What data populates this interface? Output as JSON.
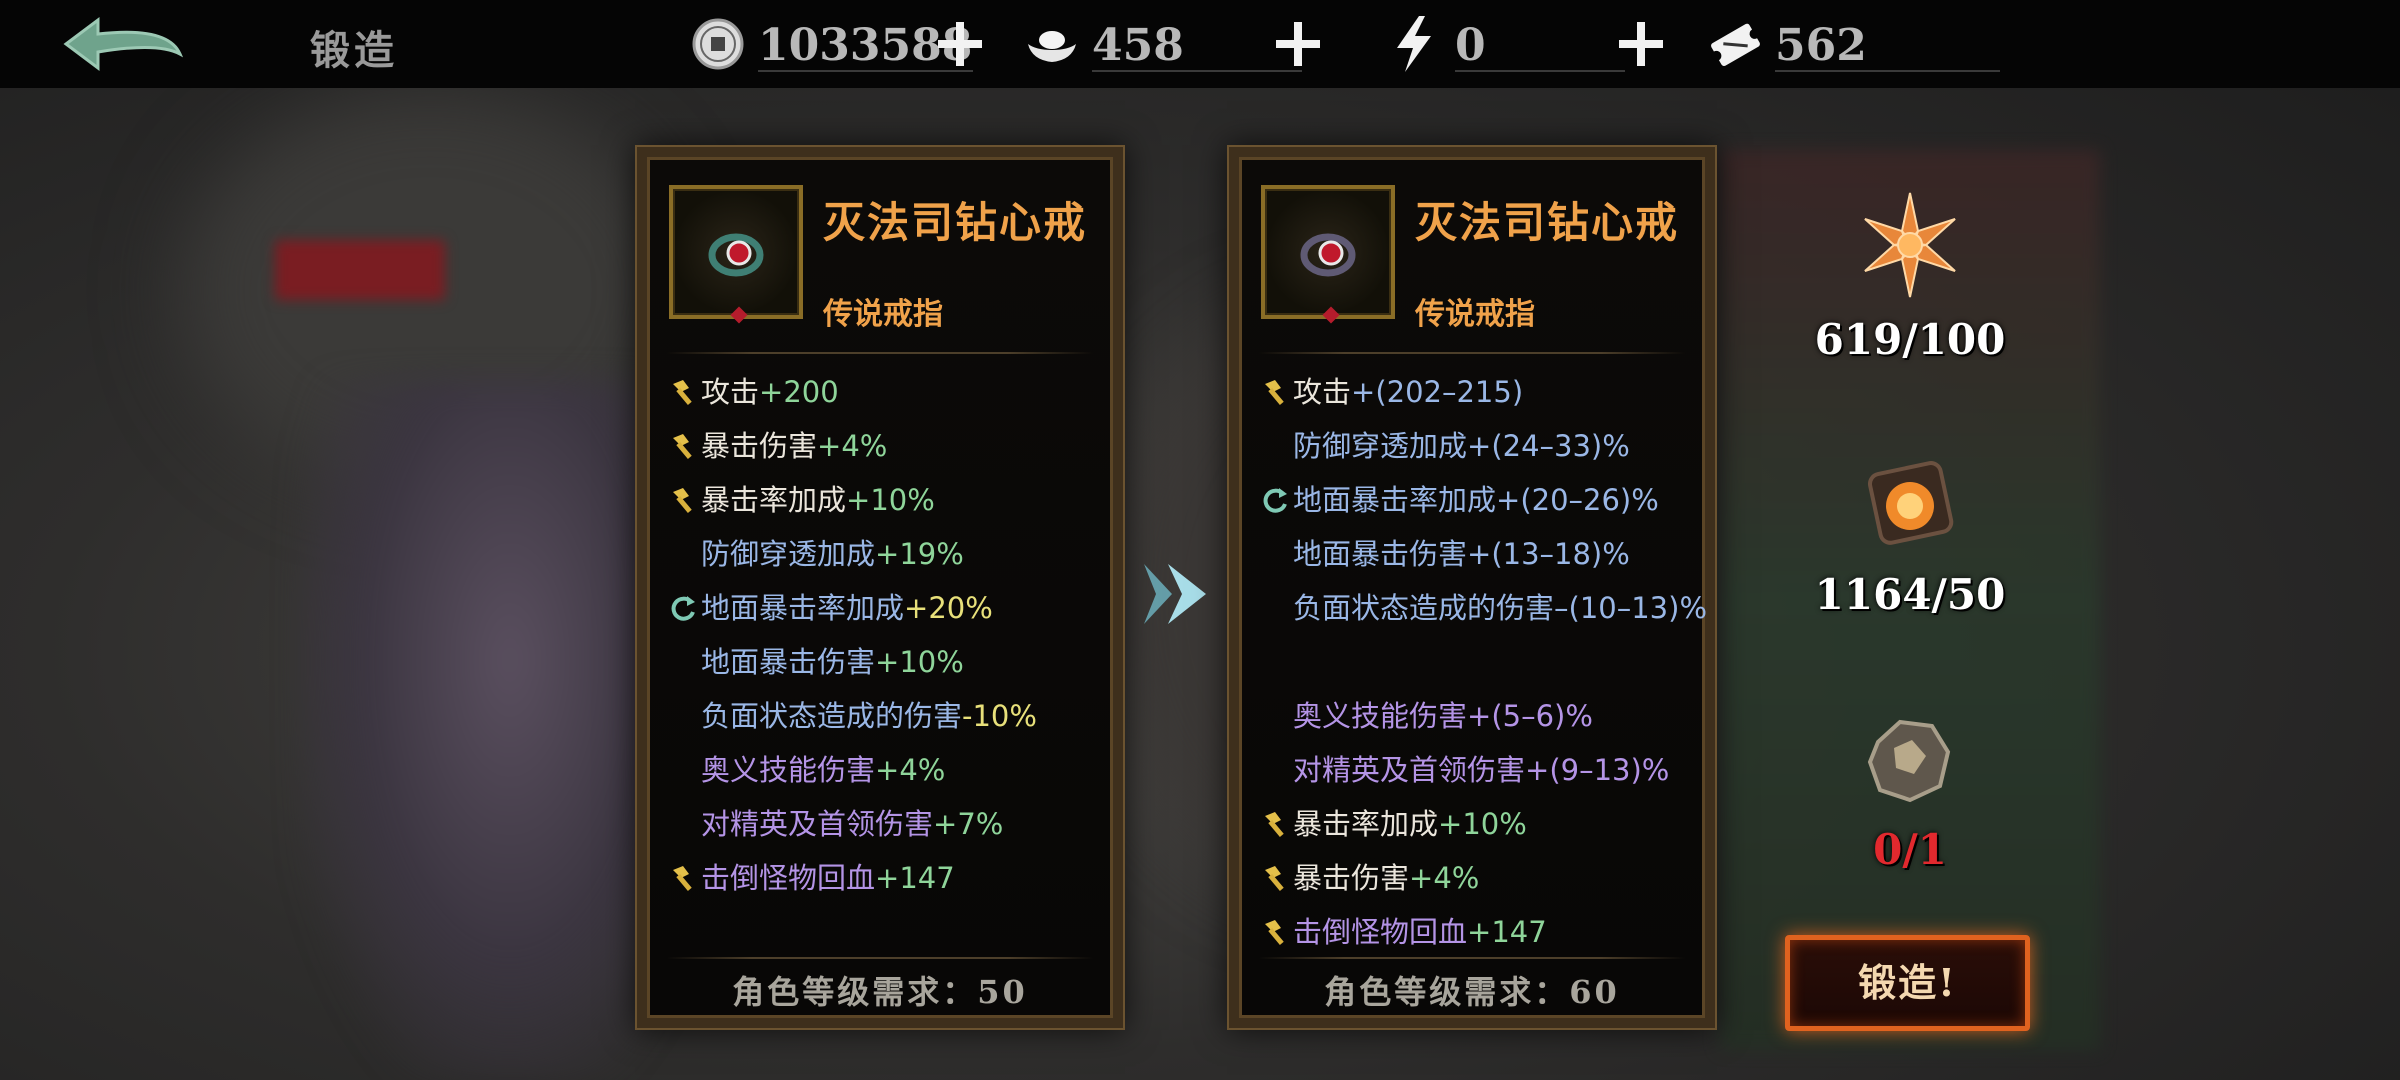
{
  "header": {
    "title": "锻造",
    "currencies": [
      {
        "name": "coin-icon",
        "value": "1033588"
      },
      {
        "name": "ingot-icon",
        "value": "458"
      },
      {
        "name": "energy-icon",
        "value": "0"
      },
      {
        "name": "ticket-icon",
        "value": "562"
      }
    ]
  },
  "current_item": {
    "name": "灭法司钻心戒",
    "type": "传说戒指",
    "stats": [
      {
        "icon": "hammer-icon",
        "name": "攻击",
        "value": "+200"
      },
      {
        "icon": "hammer-icon",
        "name": "暴击伤害",
        "value": "+4%"
      },
      {
        "icon": "hammer-icon",
        "name": "暴击率加成",
        "value": "+10%"
      },
      {
        "icon": "",
        "name": "防御穿透加成",
        "value": "+19%"
      },
      {
        "icon": "refresh-icon",
        "name": "地面暴击率加成",
        "value": "+20%"
      },
      {
        "icon": "",
        "name": "地面暴击伤害",
        "value": "+10%"
      },
      {
        "icon": "",
        "name": "负面状态造成的伤害",
        "value": "-10%"
      },
      {
        "icon": "",
        "name": "奥义技能伤害",
        "value": "+4%"
      },
      {
        "icon": "",
        "name": "对精英及首领伤害",
        "value": "+7%"
      },
      {
        "icon": "hammer-icon",
        "name": "击倒怪物回血",
        "value": "+147"
      }
    ],
    "level_requirement": "角色等级需求：50"
  },
  "forged_item": {
    "name": "灭法司钻心戒",
    "type": "传说戒指",
    "stats": [
      {
        "icon": "hammer-icon",
        "name": "攻击",
        "value": "+(202–215)"
      },
      {
        "icon": "",
        "name": "防御穿透加成",
        "value": "+(24–33)%"
      },
      {
        "icon": "refresh-icon",
        "name": "地面暴击率加成",
        "value": "+(20–26)%"
      },
      {
        "icon": "",
        "name": "地面暴击伤害",
        "value": "+(13–18)%"
      },
      {
        "icon": "",
        "name": "负面状态造成的伤害",
        "value": "–(10–13)%"
      },
      {
        "icon": "",
        "name": "奥义技能伤害",
        "value": "+(5–6)%"
      },
      {
        "icon": "",
        "name": "对精英及首领伤害",
        "value": "+(9–13)%"
      },
      {
        "icon": "hammer-icon",
        "name": "暴击率加成",
        "value": "+10%"
      },
      {
        "icon": "hammer-icon",
        "name": "暴击伤害",
        "value": "+4%"
      },
      {
        "icon": "hammer-icon",
        "name": "击倒怪物回血",
        "value": "+147"
      }
    ],
    "level_requirement": "角色等级需求：60"
  },
  "materials": [
    {
      "icon": "snowflake-crystal-icon",
      "count": "619/100"
    },
    {
      "icon": "fire-core-icon",
      "count": "1164/50"
    },
    {
      "icon": "ore-stone-icon",
      "count": "0/1"
    }
  ],
  "forge_button": "锻造!",
  "colors": {
    "accent_orange": "#f0a24a",
    "stat_green": "#8fd59a",
    "stat_yellow": "#e8e07a",
    "stat_blue": "#9ab7e6",
    "stat_purple": "#b494e6",
    "insufficient_red": "#e2292e",
    "button_glow": "#e0621f"
  }
}
